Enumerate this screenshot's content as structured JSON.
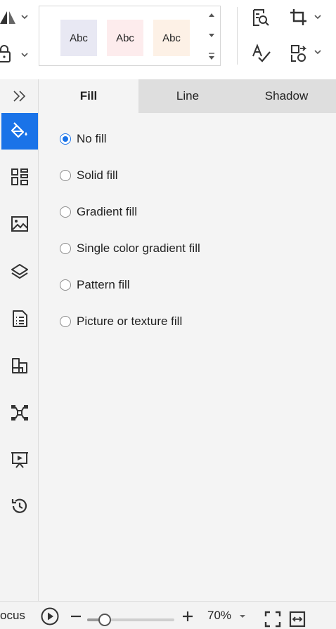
{
  "toolbar": {
    "icons": [
      "triangle-shape-icon",
      "lock-icon",
      "find-replace-icon",
      "crop-icon",
      "spell-check-icon",
      "replace-shape-icon"
    ],
    "style_gallery": {
      "chips": [
        {
          "label": "Abc",
          "bg": "#e8e8f3"
        },
        {
          "label": "Abc",
          "bg": "#fdeced"
        },
        {
          "label": "Abc",
          "bg": "#fdf1e6"
        }
      ]
    }
  },
  "sidebar": {
    "items": [
      {
        "name": "expand-panel",
        "icon": "double-chevron-right-icon"
      },
      {
        "name": "fill",
        "icon": "paint-bucket-icon",
        "active": true
      },
      {
        "name": "layout",
        "icon": "grid-layout-icon"
      },
      {
        "name": "image",
        "icon": "image-icon"
      },
      {
        "name": "layers",
        "icon": "layers-icon"
      },
      {
        "name": "page",
        "icon": "document-list-icon"
      },
      {
        "name": "shapes",
        "icon": "blocks-icon"
      },
      {
        "name": "connectors",
        "icon": "network-icon"
      },
      {
        "name": "presentation",
        "icon": "presentation-icon"
      },
      {
        "name": "history",
        "icon": "history-icon"
      }
    ]
  },
  "panel": {
    "tabs": [
      {
        "label": "Fill",
        "active": true
      },
      {
        "label": "Line",
        "active": false
      },
      {
        "label": "Shadow",
        "active": false
      }
    ],
    "fill_options": [
      {
        "label": "No fill",
        "checked": true
      },
      {
        "label": "Solid fill",
        "checked": false
      },
      {
        "label": "Gradient fill",
        "checked": false
      },
      {
        "label": "Single color gradient fill",
        "checked": false
      },
      {
        "label": "Pattern fill",
        "checked": false
      },
      {
        "label": "Picture or texture fill",
        "checked": false
      }
    ]
  },
  "statusbar": {
    "focus_label": "ocus",
    "zoom_value": "70%",
    "zoom_level": 0.2
  },
  "colors": {
    "accent": "#1a73e8"
  }
}
